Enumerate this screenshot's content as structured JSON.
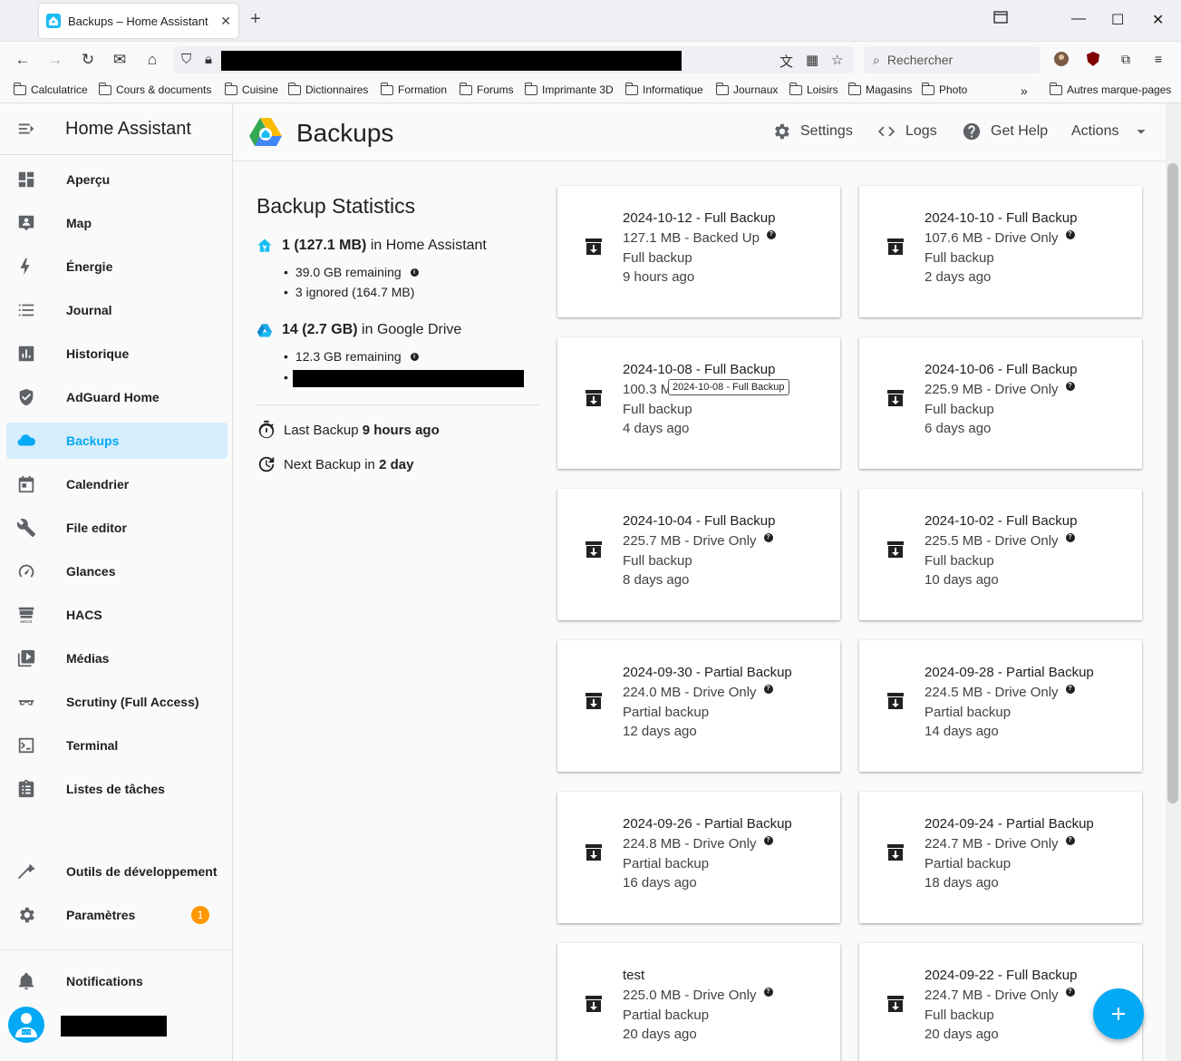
{
  "browser": {
    "tab_title": "Backups – Home Assistant",
    "search_placeholder": "Rechercher",
    "bookmarks": [
      "Calculatrice",
      "Cours & documents",
      "Cuisine",
      "Dictionnaires",
      "Formation",
      "Forums",
      "Imprimante 3D",
      "Informatique",
      "Journaux",
      "Loisirs",
      "Magasins",
      "Photo"
    ],
    "other_bookmarks": "Autres marque-pages"
  },
  "sidebar": {
    "title": "Home Assistant",
    "items": [
      {
        "label": "Aperçu",
        "icon": "dashboard-icon"
      },
      {
        "label": "Map",
        "icon": "map-account-icon"
      },
      {
        "label": "Énergie",
        "icon": "lightning-icon"
      },
      {
        "label": "Journal",
        "icon": "list-icon"
      },
      {
        "label": "Historique",
        "icon": "chart-box-icon"
      },
      {
        "label": "AdGuard Home",
        "icon": "shield-check-icon"
      },
      {
        "label": "Backups",
        "icon": "cloud-icon",
        "active": true
      },
      {
        "label": "Calendrier",
        "icon": "calendar-icon"
      },
      {
        "label": "File editor",
        "icon": "wrench-icon"
      },
      {
        "label": "Glances",
        "icon": "speedometer-icon"
      },
      {
        "label": "HACS",
        "icon": "hacs-store-icon"
      },
      {
        "label": "Médias",
        "icon": "play-box-icon"
      },
      {
        "label": "Scrutiny (Full Access)",
        "icon": "glasses-icon"
      },
      {
        "label": "Terminal",
        "icon": "console-icon"
      },
      {
        "label": "Listes de tâches",
        "icon": "clipboard-list-icon"
      }
    ],
    "dev_tools": "Outils de développement",
    "settings": "Paramètres",
    "settings_badge": "1",
    "notifications": "Notifications"
  },
  "header": {
    "title": "Backups",
    "settings": "Settings",
    "logs": "Logs",
    "help": "Get Help",
    "actions": "Actions"
  },
  "stats": {
    "title": "Backup Statistics",
    "ha_count": "1 (127.1 MB)",
    "ha_location": " in Home Assistant",
    "ha_remaining": "39.0 GB remaining",
    "ha_ignored": "3 ignored (164.7 MB)",
    "drive_count": "14 (2.7 GB)",
    "drive_location": " in Google Drive",
    "drive_remaining": "12.3 GB remaining",
    "last_backup_label": "Last Backup ",
    "last_backup_value": "9 hours ago",
    "next_backup_label": "Next Backup in ",
    "next_backup_value": "2 day"
  },
  "backups": [
    {
      "name": "2024-10-12 - Full Backup",
      "size": "127.1 MB - Backed Up",
      "type": "Full backup",
      "ago": "9 hours ago"
    },
    {
      "name": "2024-10-10 - Full Backup",
      "size": "107.6 MB - Drive Only",
      "type": "Full backup",
      "ago": "2 days ago"
    },
    {
      "name": "2024-10-08 - Full Backup",
      "size": "100.3 M",
      "type": "Full backup",
      "ago": "4 days ago",
      "tooltip": "2024-10-08 - Full Backup"
    },
    {
      "name": "2024-10-06 - Full Backup",
      "size": "225.9 MB - Drive Only",
      "type": "Full backup",
      "ago": "6 days ago"
    },
    {
      "name": "2024-10-04 - Full Backup",
      "size": "225.7 MB - Drive Only",
      "type": "Full backup",
      "ago": "8 days ago"
    },
    {
      "name": "2024-10-02 - Full Backup",
      "size": "225.5 MB - Drive Only",
      "type": "Full backup",
      "ago": "10 days ago"
    },
    {
      "name": "2024-09-30 - Partial Backup",
      "size": "224.0 MB - Drive Only",
      "type": "Partial backup",
      "ago": "12 days ago"
    },
    {
      "name": "2024-09-28 - Partial Backup",
      "size": "224.5 MB - Drive Only",
      "type": "Partial backup",
      "ago": "14 days ago"
    },
    {
      "name": "2024-09-26 - Partial Backup",
      "size": "224.8 MB - Drive Only",
      "type": "Partial backup",
      "ago": "16 days ago"
    },
    {
      "name": "2024-09-24 - Partial Backup",
      "size": "224.7 MB - Drive Only",
      "type": "Partial backup",
      "ago": "18 days ago"
    },
    {
      "name": "test",
      "size": "225.0 MB - Drive Only",
      "type": "Partial backup",
      "ago": "20 days ago"
    },
    {
      "name": "2024-09-22 - Full Backup",
      "size": "224.7 MB - Drive Only",
      "type": "Full backup",
      "ago": "20 days ago"
    }
  ],
  "colors": {
    "accent": "#03a9f4",
    "active_bg": "#d6edfb",
    "badge": "#ff9800"
  }
}
